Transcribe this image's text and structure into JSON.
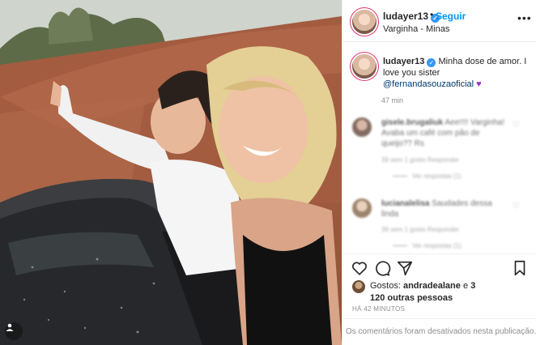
{
  "post": {
    "username": "ludayer13",
    "verified_badge": "✓",
    "separator": "•",
    "follow_label": "Seguir",
    "location": "Varginha - Minas",
    "more_icon": "more-options-icon"
  },
  "caption": {
    "username": "ludayer13",
    "text": "Minha dose de amor. I love you sister ",
    "mention": "@fernandasouzaoficial",
    "emoji": "♥",
    "time": "47 min"
  },
  "comments": [
    {
      "username": "gisele.brugaliuk",
      "text": "Aee!!!! Varginha! Avaba um café com pão de queijo?? Rs",
      "meta": "39 sem  1 gosto  Responder",
      "replies": "Ver respostas (1)"
    },
    {
      "username": "lucianalelisa",
      "text": "Saudades dessa linda",
      "meta": "39 sem  1 gosto  Responder",
      "replies": "Ver respostas (1)"
    }
  ],
  "actions": {
    "like_icon": "heart-icon",
    "comment_icon": "comment-icon",
    "share_icon": "share-icon",
    "save_icon": "bookmark-icon"
  },
  "likes": {
    "prefix": "Gostos: ",
    "user": "andradealane",
    "conjunction": " e ",
    "others": "3 120 outras pessoas"
  },
  "timestamp": "HÁ 42 MINUTOS",
  "comments_disabled": "Os comentários foram desativados nesta publicação.",
  "colors": {
    "accent": "#0095f6",
    "verified": "#3897f0",
    "mention": "#00376b",
    "muted": "#8e8e8e"
  }
}
